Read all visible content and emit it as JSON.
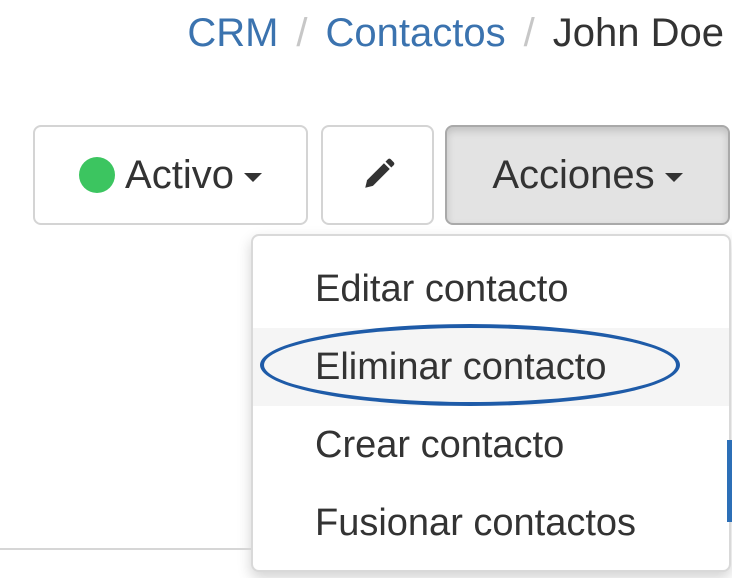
{
  "breadcrumb": {
    "items": [
      "CRM",
      "Contactos"
    ],
    "separator": "/",
    "current": "John Doe"
  },
  "toolbar": {
    "status_label": "Activo",
    "status_color": "#3cc560",
    "edit_icon": "pencil-icon",
    "actions_label": "Acciones"
  },
  "actions_menu": {
    "items": [
      {
        "label": "Editar contacto"
      },
      {
        "label": "Eliminar contacto",
        "highlighted": true
      },
      {
        "label": "Crear contacto"
      },
      {
        "label": "Fusionar contactos"
      }
    ]
  },
  "colors": {
    "link": "#3b73af",
    "highlight_ring": "#1e5ba8"
  }
}
